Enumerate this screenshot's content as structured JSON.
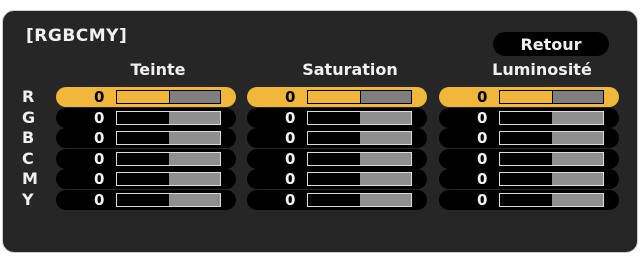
{
  "panel": {
    "title": "[RGBCMY]",
    "back_label": "Retour"
  },
  "columns": [
    "Teinte",
    "Saturation",
    "Luminosité"
  ],
  "rows": [
    "R",
    "G",
    "B",
    "C",
    "M",
    "Y"
  ],
  "values": [
    [
      "0",
      "0",
      "0"
    ],
    [
      "0",
      "0",
      "0"
    ],
    [
      "0",
      "0",
      "0"
    ],
    [
      "0",
      "0",
      "0"
    ],
    [
      "0",
      "0",
      "0"
    ],
    [
      "0",
      "0",
      "0"
    ]
  ],
  "slider_levels": [
    [
      0.5,
      0.5,
      0.5
    ],
    [
      0.5,
      0.5,
      0.5
    ],
    [
      0.5,
      0.5,
      0.5
    ],
    [
      0.5,
      0.5,
      0.5
    ],
    [
      0.5,
      0.5,
      0.5
    ],
    [
      0.5,
      0.5,
      0.5
    ]
  ],
  "selected_row": 0,
  "colors": {
    "accent": "#f0b73a",
    "panel_bg": "#262626"
  }
}
